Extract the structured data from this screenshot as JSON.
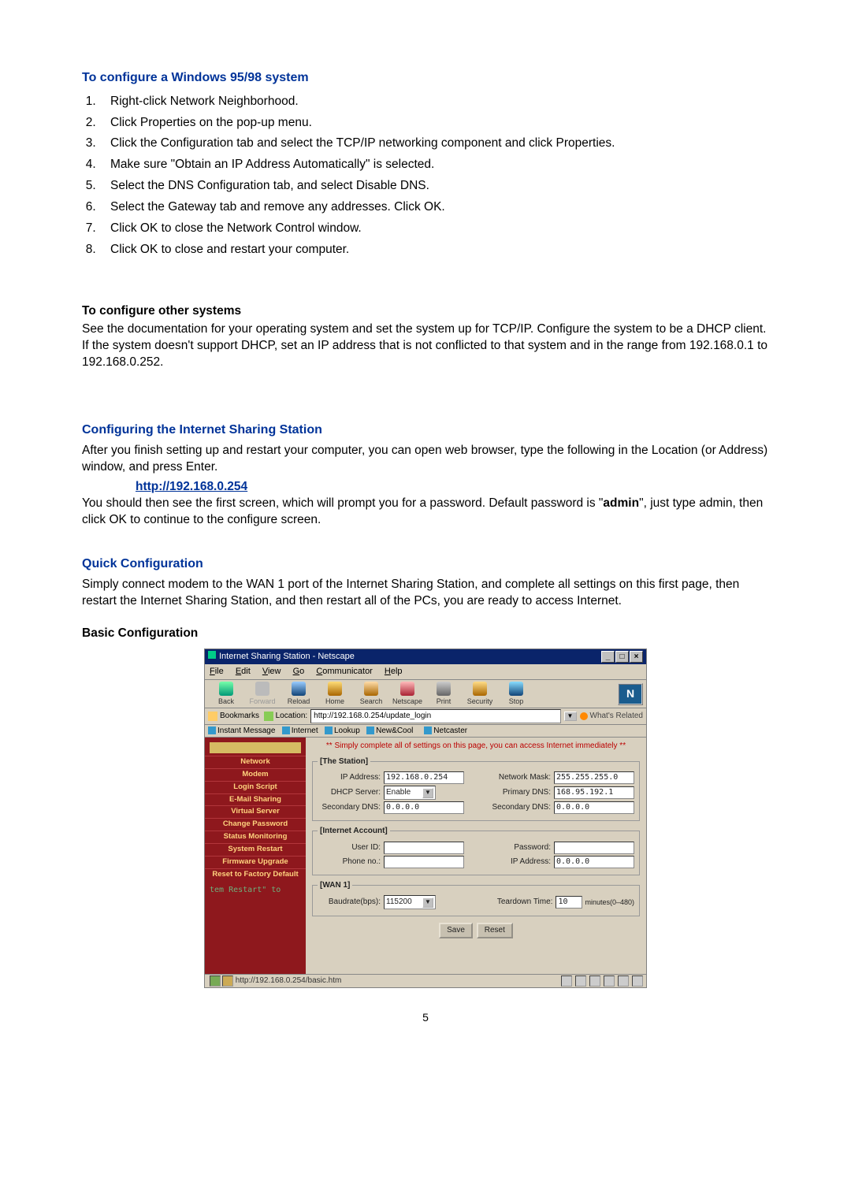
{
  "section1": {
    "title": "To configure a Windows 95/98 system",
    "steps": [
      "Right-click Network Neighborhood.",
      "Click Properties on the pop-up menu.",
      "Click the Configuration tab and select the TCP/IP networking component and click Properties.",
      "Make sure \"Obtain an IP Address Automatically\" is selected.",
      "Select the DNS Configuration tab, and select Disable DNS.",
      "Select the Gateway tab and remove any addresses. Click OK.",
      "Click OK to close the Network Control window.",
      "Click OK to close and restart your computer."
    ]
  },
  "section2": {
    "title": "To configure other systems",
    "body": "See the documentation for your operating system and set the system up for TCP/IP. Configure the system to be a DHCP client. If the system doesn't support DHCP, set an IP address that is not conflicted to that system and in the range from 192.168.0.1 to 192.168.0.252."
  },
  "section3": {
    "title": "Configuring the Internet Sharing Station",
    "body1": "After you finish setting up and restart your computer, you can open web browser, type the following in the Location (or Address) window, and press Enter.",
    "url": "http://192.168.0.254",
    "body2a": "You should then see the first screen, which will prompt you for a password. Default password is \"",
    "body2_bold": "admin",
    "body2b": "\", just type admin, then click OK to continue to the configure screen."
  },
  "section4": {
    "title": "Quick Configuration",
    "body": "Simply connect modem to the WAN 1 port of the Internet Sharing Station, and complete all settings on this first page, then restart the Internet Sharing Station, and then restart all of the PCs, you are ready to access Internet."
  },
  "section5": {
    "title": "Basic Configuration"
  },
  "page_number": "5",
  "browser": {
    "title": "Internet Sharing Station - Netscape",
    "menus": {
      "file": "File",
      "edit": "Edit",
      "view": "View",
      "go": "Go",
      "comm": "Communicator",
      "help": "Help"
    },
    "toolbar": {
      "back": "Back",
      "forward": "Forward",
      "reload": "Reload",
      "home": "Home",
      "search": "Search",
      "netscape": "Netscape",
      "print": "Print",
      "security": "Security",
      "stop": "Stop"
    },
    "bookmarks_label": "Bookmarks",
    "location_label": "Location:",
    "location_value": "http://192.168.0.254/update_login",
    "whats_related": "What's Related",
    "personal": {
      "im": "Instant Message",
      "internet": "Internet",
      "lookup": "Lookup",
      "newcool": "New&Cool",
      "netcaster": "Netcaster"
    },
    "sidebar": {
      "items": [
        "Network",
        "Modem",
        "Login Script",
        "E-Mail Sharing",
        "Virtual Server",
        "Change Password",
        "Status Monitoring",
        "System Restart",
        "Firmware Upgrade",
        "Reset to Factory Default"
      ],
      "note": "tem Restart\" to"
    },
    "main": {
      "banner": "** Simply complete all of settings on this page, you can access Internet immediately **",
      "grp_station": "[The Station]",
      "grp_account": "[Internet Account]",
      "grp_wan": "[WAN 1]",
      "labels": {
        "ip": "IP Address:",
        "mask": "Network Mask:",
        "dhcp": "DHCP Server:",
        "pdns": "Primary DNS:",
        "sdns1": "Secondary DNS:",
        "sdns2": "Secondary DNS:",
        "user": "User ID:",
        "pass": "Password:",
        "phone": "Phone no.:",
        "ip2": "IP Address:",
        "baud": "Baudrate(bps):",
        "tear": "Teardown Time:",
        "tear_unit": "minutes(0–480)"
      },
      "values": {
        "ip": "192.168.0.254",
        "mask": "255.255.255.0",
        "dhcp": "Enable",
        "pdns": "168.95.192.1",
        "sdns1": "0.0.0.0",
        "sdns2": "0.0.0.0",
        "user": "",
        "pass": "",
        "phone": "",
        "ip2": "0.0.0.0",
        "baud": "115200",
        "tear": "10"
      },
      "save": "Save",
      "reset": "Reset"
    },
    "status": "http://192.168.0.254/basic.htm"
  }
}
